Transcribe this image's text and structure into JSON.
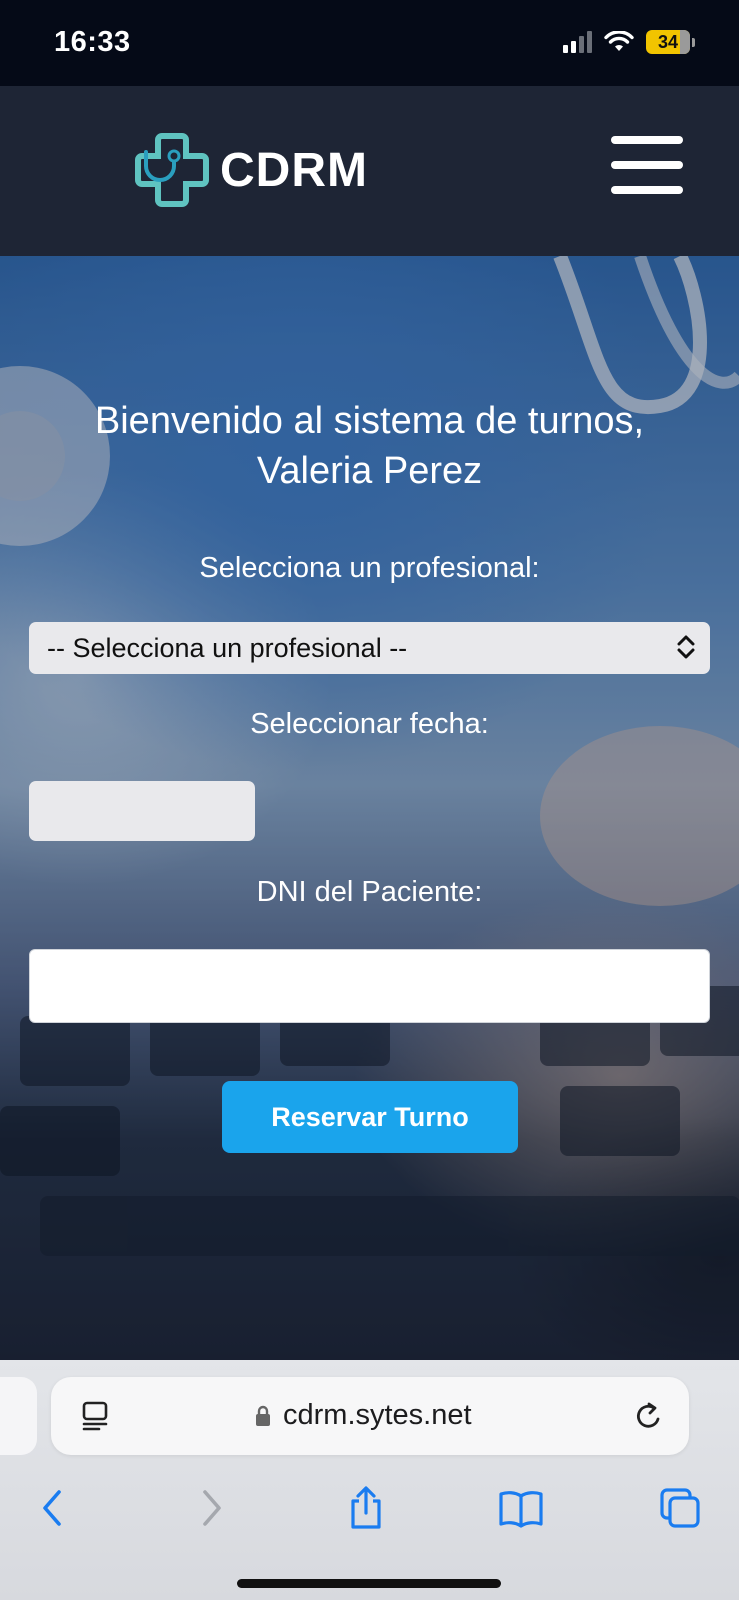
{
  "status_bar": {
    "time": "16:33",
    "battery": "34",
    "icons": [
      "signal-icon",
      "wifi-icon",
      "battery-icon"
    ]
  },
  "header": {
    "logo_text": "CDRM",
    "logo_icon": "stethoscope-cross-icon",
    "menu_icon": "hamburger-menu-icon"
  },
  "main": {
    "welcome_line1": "Bienvenido al sistema de turnos,",
    "welcome_line2": "Valeria Perez",
    "professional_label": "Selecciona un profesional:",
    "professional_selected": "-- Selecciona un profesional --",
    "date_label": "Seleccionar fecha:",
    "date_value": "",
    "dni_label": "DNI del Paciente:",
    "dni_value": "",
    "submit_label": "Reservar Turno",
    "accent_color": "#1aa4ec"
  },
  "browser": {
    "url": "cdrm.sytes.net",
    "icons": [
      "reader-icon",
      "lock-icon",
      "reload-icon",
      "back-icon",
      "forward-icon",
      "share-icon",
      "bookmarks-icon",
      "tabs-icon"
    ]
  }
}
